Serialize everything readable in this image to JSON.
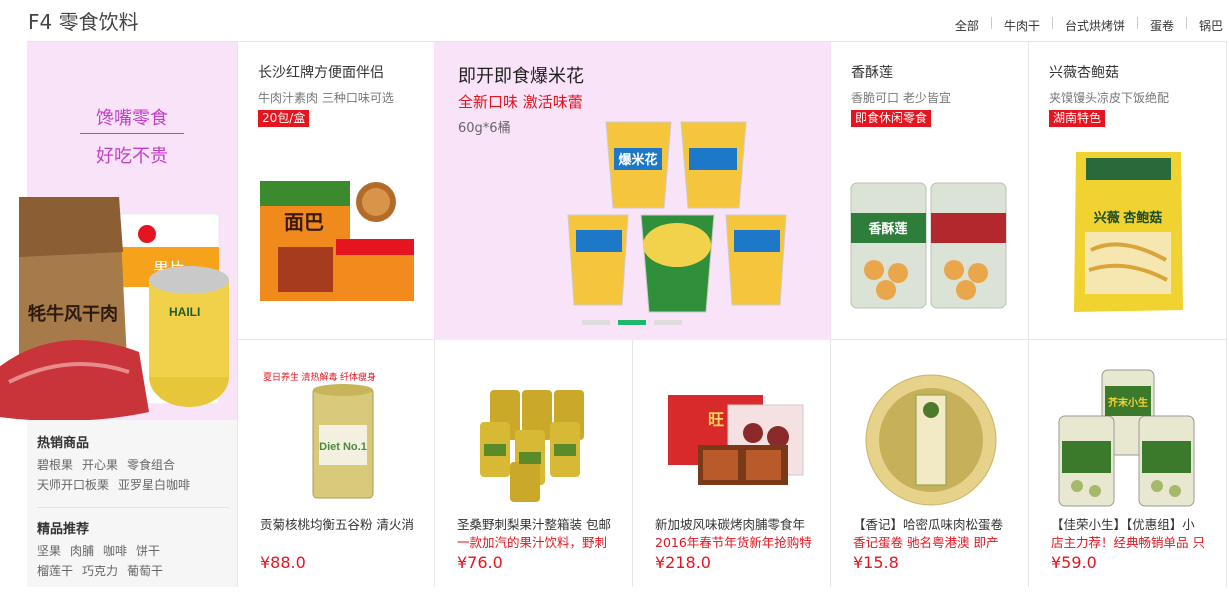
{
  "floor": {
    "title": "F4 零食饮料"
  },
  "nav": [
    "全部",
    "牛肉干",
    "台式烘烤饼",
    "蛋卷",
    "锅巴"
  ],
  "left": {
    "tag1": "馋嘴零食",
    "tag2": "好吃不贵",
    "img_texts": {
      "pack": "牦牛风干肉",
      "label": "果片",
      "can": "HAILI"
    },
    "hot": {
      "title": "热销商品",
      "links": [
        "碧根果",
        "开心果",
        "零食组合",
        "天师开口板栗",
        "亚罗星白咖啡"
      ]
    },
    "rec": {
      "title": "精品推荐",
      "links": [
        "坚果",
        "肉脯",
        "咖啡",
        "饼干",
        "榴莲干",
        "巧克力",
        "葡萄干"
      ]
    }
  },
  "top": [
    {
      "title": "长沙红牌方便面伴侣",
      "sub": "牛肉汁素肉 三种口味可选",
      "badge": "20包/盒",
      "img_text": "面巴"
    },
    {
      "title": "香酥莲",
      "sub": "香脆可口 老少皆宜",
      "badge": "即食休闲零食",
      "img_text": "香酥莲"
    },
    {
      "title": "兴薇杏鲍菇",
      "sub": "夹馍馒头凉皮下饭绝配",
      "badge": "湖南特色",
      "img_text": "兴薇 杏鲍菇"
    }
  ],
  "popcorn": {
    "title": "即开即食爆米花",
    "slogan": "全新口味 激活味蕾",
    "spec": "60g*6桶",
    "img_text": "爆米花"
  },
  "bottom": [
    {
      "line1": "贡菊核桃均衡五谷粉 清火消",
      "line2": "",
      "price": "¥88.0",
      "img_text": "夏日养生 清热解毒 纤体瘦身",
      "can_label": "Diet No.1"
    },
    {
      "line1": "圣桑野刺梨果汁整箱装 包邮",
      "line2": "一款加汽的果汁饮料，野刺",
      "price": "¥76.0"
    },
    {
      "line1": "新加坡风味碳烤肉脯零食年",
      "line2": "2016年春节年货新年抢购特",
      "price": "¥218.0",
      "img_text": "旺"
    },
    {
      "line1": "【香记】哈密瓜味肉松蛋卷",
      "line2": "香记蛋卷 驰名粤港澳 即产",
      "price": "¥15.8"
    },
    {
      "line1": "【佳荣小生】【优惠组】小",
      "line2": "店主力荐！经典畅销单品 只",
      "price": "¥59.0",
      "img_text": "芥末小生"
    }
  ],
  "colors": {
    "accent": "#e4151f",
    "pink": "#f9e3f8",
    "purple": "#c23fc7",
    "green": "#1fb86a"
  }
}
